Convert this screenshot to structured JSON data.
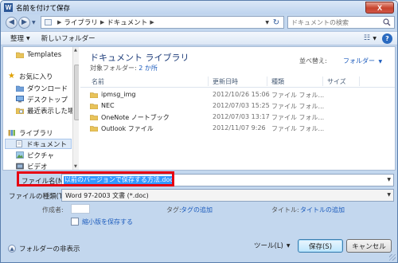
{
  "window": {
    "title": "名前を付けて保存",
    "app_icon": "word-icon",
    "close_label": "X"
  },
  "address": {
    "crumbs": [
      "ライブラリ",
      "ドキュメント"
    ],
    "search_placeholder": "ドキュメントの検索"
  },
  "toolbar": {
    "organize_label": "整理",
    "new_folder_label": "新しいフォルダー"
  },
  "nav_pane": {
    "items": [
      {
        "label": "Templates",
        "icon": "folder-icon"
      },
      {
        "label": "お気に入り",
        "icon": "star-icon"
      },
      {
        "label": "ダウンロード",
        "icon": "download-folder-icon"
      },
      {
        "label": "デスクトップ",
        "icon": "desktop-icon"
      },
      {
        "label": "最近表示した場所",
        "icon": "recent-places-icon"
      },
      {
        "label": "ライブラリ",
        "icon": "library-icon"
      },
      {
        "label": "ドキュメント",
        "icon": "documents-icon",
        "selected": true
      },
      {
        "label": "ピクチャ",
        "icon": "pictures-icon"
      },
      {
        "label": "ビデオ",
        "icon": "video-icon"
      }
    ]
  },
  "library": {
    "title": "ドキュメント ライブラリ",
    "target_label": "対象フォルダー:",
    "target_value": "2 か所",
    "sort_label": "並べ替え:",
    "sort_value": "フォルダー"
  },
  "columns": {
    "name": "名前",
    "date": "更新日時",
    "type": "種類",
    "size": "サイズ"
  },
  "files": [
    {
      "name": "ipmsg_img",
      "date": "2012/10/26 15:06",
      "type": "ファイル フォル..."
    },
    {
      "name": "NEC",
      "date": "2012/07/03 15:25",
      "type": "ファイル フォル..."
    },
    {
      "name": "OneNote ノートブック",
      "date": "2012/07/03 13:17",
      "type": "ファイル フォル..."
    },
    {
      "name": "Outlook ファイル",
      "date": "2012/11/07 9:26",
      "type": "ファイル フォル..."
    }
  ],
  "form": {
    "filename_label": "ファイル名(N):",
    "filename_value": "以前のバージョンで保存する方法.doc",
    "filetype_label": "ファイルの種類(T):",
    "filetype_value": "Word 97-2003 文書 (*.doc)",
    "author_label": "作成者:",
    "tags_label": "タグ:",
    "tags_value": "タグの追加",
    "title_label": "タイトル:",
    "title_value": "タイトルの追加",
    "thumbnail_label": "縮小版を保存する"
  },
  "footer": {
    "hide_folders_label": "フォルダーの非表示",
    "tools_label": "ツール(L)",
    "save_label": "保存(S)",
    "cancel_label": "キャンセル"
  },
  "colors": {
    "highlight": "#e60012",
    "selection": "#3399ff",
    "link": "#1d5cbd"
  }
}
